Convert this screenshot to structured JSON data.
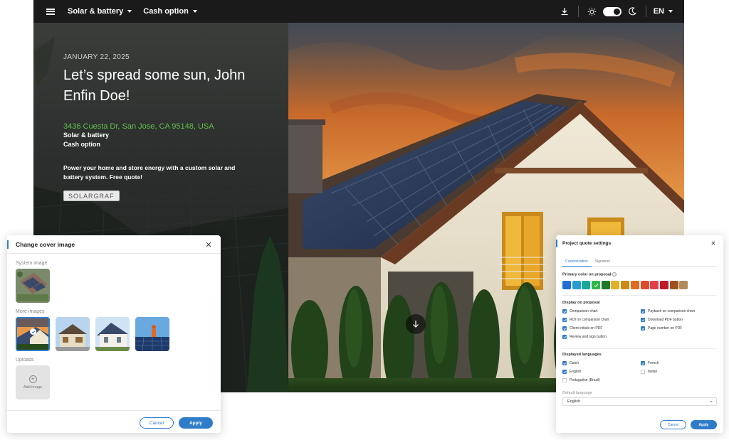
{
  "topbar": {
    "menu_solar": "Solar & battery",
    "menu_cash": "Cash option",
    "language": "EN",
    "icons": [
      "hamburger-icon",
      "download-icon",
      "sun-icon",
      "moon-icon",
      "chevron-down-icon"
    ]
  },
  "hero": {
    "date": "JANUARY 22, 2025",
    "headline": "Let’s spread some sun, John Enfin Doe!",
    "address": "3436 Cuesta Dr, San Jose, CA 95148, USA",
    "system_type": "Solar & battery",
    "payment_type": "Cash option",
    "blurb": "Power your home and store energy with a custom solar and battery system. Free quote!",
    "logo_text": "SOLARGRAF",
    "colors": {
      "address": "#5fbf4a",
      "panel": "#232624"
    }
  },
  "cover_modal": {
    "title": "Change cover image",
    "system_image_label": "System image",
    "more_images_label": "More images",
    "uploads_label": "Uploads",
    "add_image_label": "Add image",
    "cancel_label": "Cancel",
    "apply_label": "Apply"
  },
  "quote_modal": {
    "title": "Project quote settings",
    "tabs": [
      "Customization",
      "Signature"
    ],
    "primary_color_label": "Primary color on proposal",
    "swatch_colors": [
      "#1f6fd6",
      "#2a9bd1",
      "#1aa89a",
      "#2eb84a",
      "#1a7a2a",
      "#e0b02a",
      "#cc8a12",
      "#e06a1e",
      "#e04a2a",
      "#e0404a",
      "#c01a2a",
      "#a0521e",
      "#b08a5a"
    ],
    "selected_swatch_index": 3,
    "display_label": "Display on proposal",
    "display_options": [
      {
        "label": "Comparison chart",
        "checked": true
      },
      {
        "label": "Payback on comparison chart",
        "checked": true
      },
      {
        "label": "ROI on comparison chart",
        "checked": true
      },
      {
        "label": "Download PDF button",
        "checked": true
      },
      {
        "label": "Client initials on PDF",
        "checked": true
      },
      {
        "label": "Page number on PDF",
        "checked": true
      },
      {
        "label": "Review and sign button",
        "checked": true
      }
    ],
    "languages_label": "Displayed languages",
    "languages": [
      {
        "label": "Dutch",
        "checked": true
      },
      {
        "label": "French",
        "checked": true
      },
      {
        "label": "English",
        "checked": true
      },
      {
        "label": "Italian",
        "checked": false
      },
      {
        "label": "Portuguêse (Brazil)",
        "checked": false
      }
    ],
    "default_language_label": "Default language",
    "default_language_value": "English",
    "cancel_label": "Cancel",
    "apply_label": "Apply",
    "accent_color": "#2f7cc9"
  }
}
